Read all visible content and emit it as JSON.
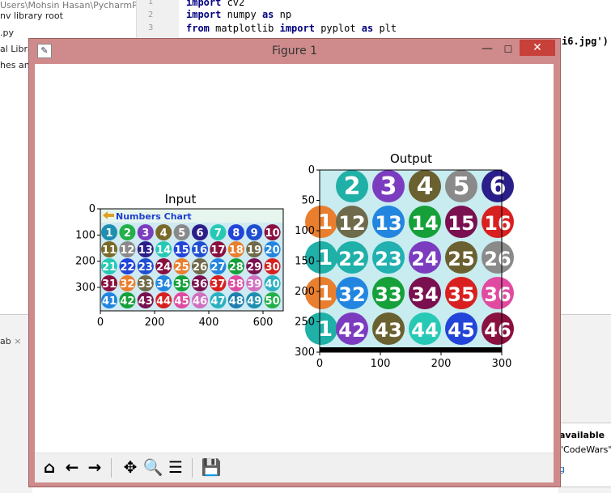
{
  "ide": {
    "left_rows": [
      "Users\\Mohsin Hasan\\PycharmP",
      "nv  library root",
      ".py",
      "al Libra",
      "hes and"
    ],
    "line_numbers": [
      "1",
      "2",
      "3"
    ],
    "code_lines": [
      {
        "parts": [
          {
            "t": "import",
            "c": "kw"
          },
          {
            "t": " cv2",
            "c": ""
          }
        ]
      },
      {
        "parts": [
          {
            "t": "import",
            "c": "kw"
          },
          {
            "t": " numpy ",
            "c": ""
          },
          {
            "t": "as",
            "c": "kw"
          },
          {
            "t": " np",
            "c": ""
          }
        ]
      },
      {
        "parts": [
          {
            "t": "from",
            "c": "kw"
          },
          {
            "t": " matplotlib ",
            "c": ""
          },
          {
            "t": "import",
            "c": "kw"
          },
          {
            "t": " pyplot ",
            "c": ""
          },
          {
            "t": "as",
            "c": "kw"
          },
          {
            "t": " plt",
            "c": ""
          }
        ]
      }
    ],
    "hidden_line_tail": "i6.jpg')",
    "bottom_tab": "ab",
    "right_panel": [
      "available",
      "\"CodeWars\"",
      "g"
    ]
  },
  "figure": {
    "title": "Figure 1",
    "app_icon": "matplotlib-icon",
    "controls": {
      "minimize": "—",
      "maximize": "☐",
      "close": "✕"
    }
  },
  "toolbar": {
    "buttons": [
      {
        "name": "home-icon",
        "glyph": "⌂"
      },
      {
        "name": "back-icon",
        "glyph": "←"
      },
      {
        "name": "forward-icon",
        "glyph": "→"
      },
      {
        "name": "pan-icon",
        "glyph": "✥"
      },
      {
        "name": "zoom-icon",
        "glyph": "🔍"
      },
      {
        "name": "subplots-icon",
        "glyph": "☰"
      },
      {
        "name": "save-icon",
        "glyph": "💾"
      }
    ]
  },
  "chart_data": [
    {
      "type": "image",
      "title": "Input",
      "x_ticks": [
        "0",
        "200",
        "400",
        "600"
      ],
      "y_ticks": [
        "0",
        "100",
        "200",
        "300"
      ],
      "xlim": [
        0,
        675
      ],
      "ylim": [
        390,
        0
      ],
      "image_header": "Numbers Chart",
      "grid_numbers": [
        1,
        2,
        3,
        4,
        5,
        6,
        7,
        8,
        9,
        10,
        11,
        12,
        13,
        14,
        15,
        16,
        17,
        18,
        19,
        20,
        21,
        22,
        23,
        24,
        25,
        26,
        27,
        28,
        29,
        30,
        31,
        32,
        33,
        34,
        35,
        36,
        37,
        38,
        39,
        40,
        41,
        42,
        43,
        44,
        45,
        46,
        47,
        48,
        49,
        50
      ],
      "colors": {
        "palette": [
          "#1f8fb0",
          "#23b04a",
          "#7c3cc0",
          "#7a6a2a",
          "#8a8a8a",
          "#2a1f8a",
          "#27c9b5",
          "#2244d8",
          "#1f4fd0",
          "#8a1040",
          "#e97f2e",
          "#6e6a4a",
          "#2286e0",
          "#16a03a",
          "#7a1050",
          "#d82020",
          "#e04aa0",
          "#d070c0",
          "#2ab0c0",
          "#1f7fb0"
        ]
      }
    },
    {
      "type": "image",
      "title": "Output",
      "x_ticks": [
        "0",
        "100",
        "200",
        "300"
      ],
      "y_ticks": [
        "0",
        "50",
        "100",
        "150",
        "200",
        "250",
        "300"
      ],
      "xlim": [
        0,
        300
      ],
      "ylim": [
        300,
        0
      ],
      "grid_numbers": [
        2,
        3,
        4,
        5,
        6,
        12,
        13,
        14,
        15,
        16,
        22,
        23,
        24,
        25,
        26,
        32,
        33,
        34,
        35,
        36,
        42,
        43,
        44,
        45,
        46
      ],
      "visible_fragments": [
        "1",
        "1",
        "1",
        "1"
      ]
    }
  ]
}
